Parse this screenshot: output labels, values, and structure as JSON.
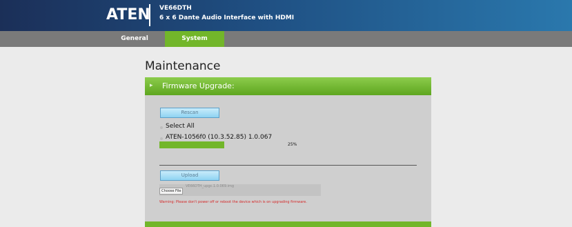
{
  "header": {
    "logo": "ATEN",
    "model": "VE66DTH",
    "description": "6 x 6 Dante Audio Interface with HDMI"
  },
  "nav": {
    "tabs": [
      {
        "label": "General",
        "active": false
      },
      {
        "label": "System",
        "active": true
      }
    ]
  },
  "page": {
    "title": "Maintenance"
  },
  "panel": {
    "title": "Firmware Upgrade:",
    "rescan_label": "Rescan",
    "select_all_label": "Select All",
    "device_label": "ATEN-1056f0 (10.3.52.85) 1.0.067",
    "progress_text": "25%",
    "progress_value": 0.25,
    "upload_label": "Upload",
    "choose_file_label": "Choose File",
    "file_name": "VE66DTH_upgc.1.0.069.img",
    "warning": "Warning: Please don't power off or reboot the device which is on upgrading firmware."
  },
  "colors": {
    "header_start": "#1b2f58",
    "header_end": "#2a78ad",
    "accent_green": "#72b62a",
    "nav_gray": "#7a7a7a",
    "warning_red": "#d42a2a"
  }
}
